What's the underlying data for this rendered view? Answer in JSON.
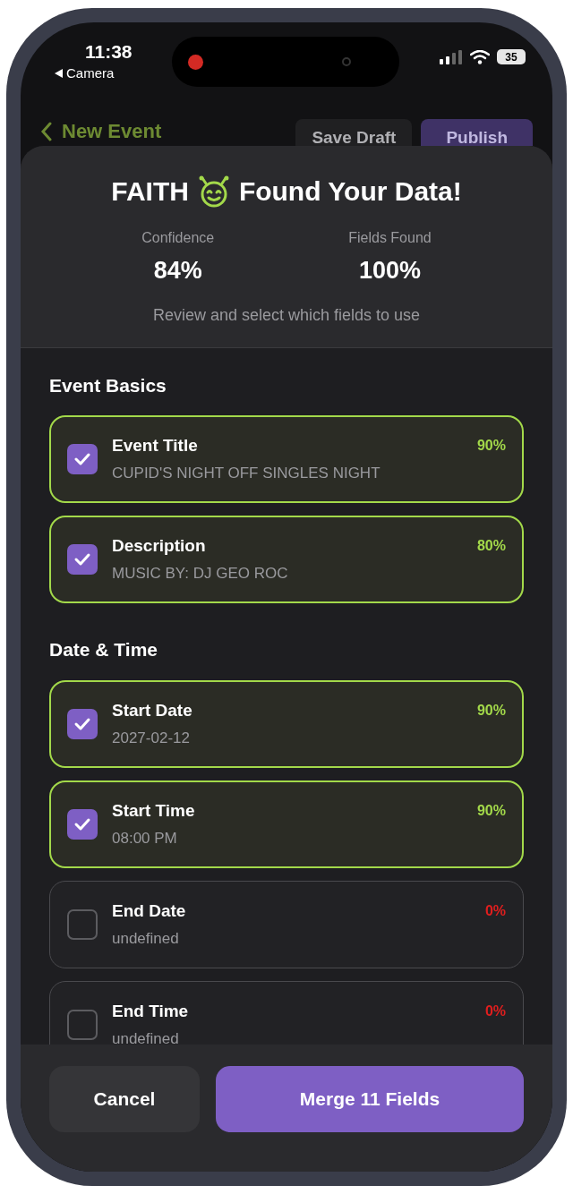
{
  "status_bar": {
    "time": "11:38",
    "back_app": "Camera",
    "battery": "35"
  },
  "nav": {
    "title": "New Event",
    "buttons": [
      "Save Draft",
      "Publish"
    ]
  },
  "sheet": {
    "title_start": "FAITH",
    "title_end": "Found Your Data!",
    "stats": [
      {
        "label": "Confidence",
        "value": "84%"
      },
      {
        "label": "Fields Found",
        "value": "100%"
      }
    ],
    "subtitle": "Review and select which fields to use",
    "sections": [
      {
        "title": "Event Basics",
        "fields": [
          {
            "label": "Event Title",
            "value": "CUPID'S NIGHT OFF SINGLES NIGHT",
            "confidence": "90%",
            "checked": true
          },
          {
            "label": "Description",
            "value": "MUSIC BY: DJ GEO ROC",
            "confidence": "80%",
            "checked": true
          }
        ]
      },
      {
        "title": "Date & Time",
        "fields": [
          {
            "label": "Start Date",
            "value": "2027-02-12",
            "confidence": "90%",
            "checked": true
          },
          {
            "label": "Start Time",
            "value": "08:00 PM",
            "confidence": "90%",
            "checked": true
          },
          {
            "label": "End Date",
            "value": "undefined",
            "confidence": "0%",
            "checked": false
          },
          {
            "label": "End Time",
            "value": "undefined",
            "confidence": "0%",
            "checked": false
          }
        ]
      }
    ],
    "actions": {
      "cancel": "Cancel",
      "merge": "Merge 11 Fields"
    }
  }
}
